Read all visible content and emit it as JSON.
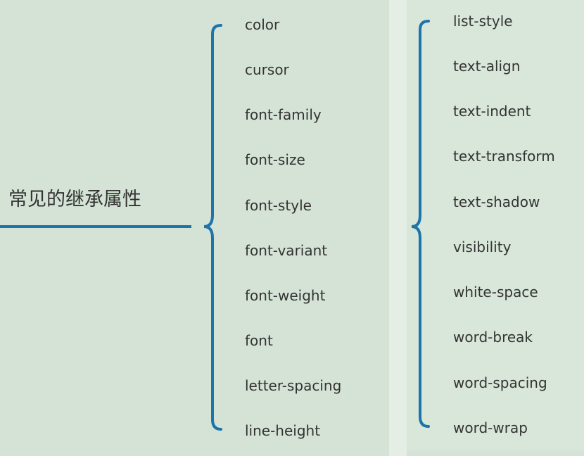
{
  "root": {
    "label": "常见的继承属性"
  },
  "columns": [
    {
      "items": [
        "color",
        "cursor",
        "font-family",
        "font-size",
        "font-style",
        "font-variant",
        "font-weight",
        "font",
        "letter-spacing",
        "line-height"
      ]
    },
    {
      "items": [
        "list-style",
        "text-align",
        "text-indent",
        "text-transform",
        "text-shadow",
        "visibility",
        "white-space",
        "word-break",
        "word-spacing",
        "word-wrap"
      ]
    }
  ],
  "colors": {
    "connector": "#1c74ab",
    "text": "#333333",
    "background": "#d4e3d5"
  }
}
